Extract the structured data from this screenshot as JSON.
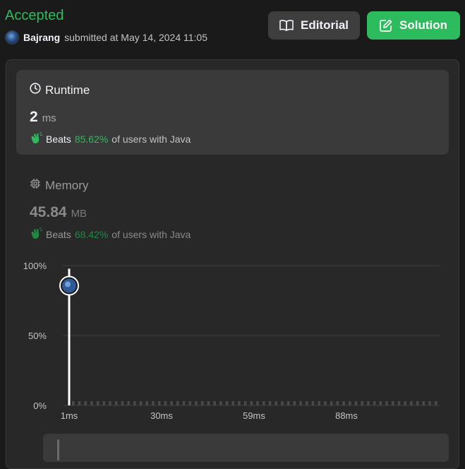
{
  "header": {
    "status": "Accepted",
    "username": "Bajrang",
    "submitted_text": "submitted at May 14, 2024 11:05",
    "editorial_label": "Editorial",
    "solution_label": "Solution"
  },
  "runtime": {
    "title": "Runtime",
    "value": "2",
    "unit": "ms",
    "beats_label": "Beats",
    "beats_pct": "85.62%",
    "beats_suffix": "of users with Java"
  },
  "memory": {
    "title": "Memory",
    "value": "45.84",
    "unit": "MB",
    "beats_label": "Beats",
    "beats_pct": "68.42%",
    "beats_suffix": "of users with Java"
  },
  "colors": {
    "accent_green": "#2cbb5d",
    "background": "#1a1a1a",
    "card": "#3a3a3a"
  },
  "chart_data": {
    "type": "bar",
    "y_ticks": [
      "100%",
      "50%",
      "0%"
    ],
    "x_ticks": [
      "1ms",
      "30ms",
      "59ms",
      "88ms"
    ],
    "ylim": [
      0,
      100
    ],
    "grid": true,
    "user_marker": {
      "x": "1ms",
      "percentile": 85.62
    },
    "bar_count": 60
  }
}
